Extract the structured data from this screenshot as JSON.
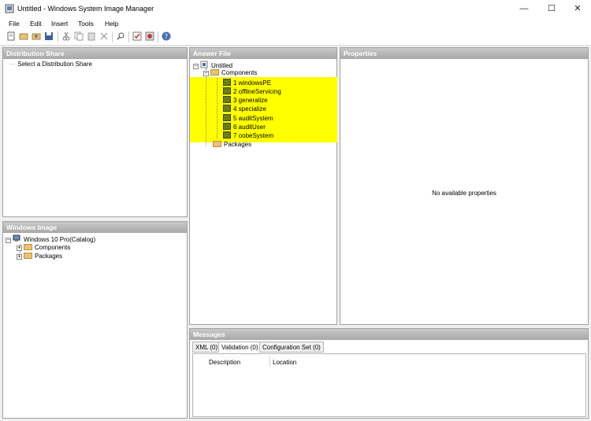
{
  "window": {
    "title": "Untitled - Windows System Image Manager",
    "minimize": "—",
    "maximize": "☐",
    "close": "✕"
  },
  "menu": [
    "File",
    "Edit",
    "Insert",
    "Tools",
    "Help"
  ],
  "panels": {
    "distribution_share": {
      "header": "Distribution Share",
      "placeholder": "Select a Distribution Share"
    },
    "windows_image": {
      "header": "Windows Image",
      "root": "Windows 10 Pro(Catalog)",
      "children": [
        "Components",
        "Packages"
      ]
    },
    "answer_file": {
      "header": "Answer File",
      "root": "Untitled",
      "components": "Components",
      "passes": [
        "1 windowsPE",
        "2 offlineServicing",
        "3 generalize",
        "4 specialize",
        "5 auditSystem",
        "6 auditUser",
        "7 oobeSystem"
      ],
      "packages": "Packages",
      "highlight_color": "#ffff00"
    },
    "properties": {
      "header": "Properties",
      "empty_text": "No available properties"
    },
    "messages": {
      "header": "Messages",
      "tabs": [
        "XML (0)",
        "Validation (0)",
        "Configuration Set (0)"
      ],
      "active_tab": "Validation (0)",
      "columns": [
        "Description",
        "Location"
      ]
    }
  }
}
